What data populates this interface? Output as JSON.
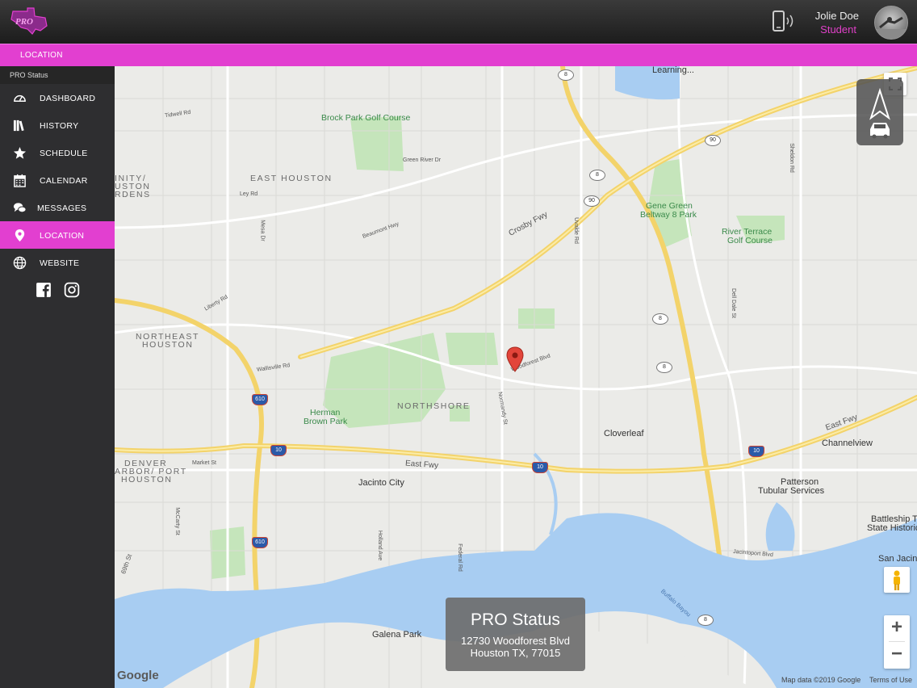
{
  "header": {
    "user_name": "Jolie Doe",
    "user_role": "Student"
  },
  "location_bar": {
    "title": "LOCATION"
  },
  "sidebar": {
    "section_title": "PRO Status",
    "items": [
      {
        "label": "DASHBOARD",
        "icon": "dashboard-icon"
      },
      {
        "label": "HISTORY",
        "icon": "books-icon"
      },
      {
        "label": "SCHEDULE",
        "icon": "star-icon"
      },
      {
        "label": "CALENDAR",
        "icon": "calendar-icon"
      },
      {
        "label": "MESSAGES",
        "icon": "chat-icon"
      },
      {
        "label": "LOCATION",
        "icon": "pin-icon",
        "active": true
      },
      {
        "label": "WEBSITE",
        "icon": "globe-icon"
      }
    ],
    "social": [
      "facebook-icon",
      "instagram-icon"
    ]
  },
  "map": {
    "areas": [
      "EAST HOUSTON",
      "NORTHEAST",
      "HOUSTON",
      "NORTHSHORE",
      "DENVER",
      "ARBOR/ PORT",
      "HOUSTON",
      "INITY/",
      "USTON",
      "RDENS"
    ],
    "places": {
      "brock_park": "Brock Park Golf Course",
      "gene_green_1": "Gene Green",
      "gene_green_2": "Beltway 8 Park",
      "river_terrace_1": "River Terrace",
      "river_terrace_2": "Golf Course",
      "herman_1": "Herman",
      "herman_2": "Brown Park",
      "cloverleaf": "Cloverleaf",
      "channelview": "Channelview",
      "jacinto_city": "Jacinto City",
      "galena_park": "Galena Park",
      "patterson_1": "Patterson",
      "patterson_2": "Tubular Services",
      "battleship_1": "Battleship T",
      "battleship_2": "State Historic",
      "san_jacinto": "San Jacinto",
      "learning": "Learning..."
    },
    "roads": {
      "crosby": "Crosby Fwy",
      "east_fwy": "East Fwy",
      "east_fwy2": "East Fwy",
      "wallisville": "Wallisville Rd",
      "woodforest": "Woodforest Blvd",
      "market": "Market St",
      "tidwell": "Tidwell Rd",
      "green_river": "Green River Dr",
      "beaumont": "Beaumont Hwy",
      "uvalde": "Uvalde Rd",
      "federal": "Federal Rd",
      "holland": "Holland Ave",
      "liberty": "Liberty Rd",
      "dell_dale": "Dell Dale St",
      "sheldon": "Sheldon Rd",
      "buffalo": "Buffalo Bayou",
      "ley": "Ley Rd",
      "mesa": "Mesa Dr",
      "normandy": "Normandy St",
      "jacintoport": "Jacintoport Blvd",
      "mccarty": "McCarty St",
      "69th": "69th St"
    },
    "shields": [
      "8",
      "90",
      "8",
      "90",
      "610",
      "10",
      "10",
      "10",
      "610",
      "8",
      "8",
      "8"
    ],
    "infobox": {
      "title": "PRO Status",
      "line1": "12730 Woodforest Blvd",
      "line2": "Houston TX, 77015"
    },
    "attribution": "Map data ©2019 Google",
    "terms": "Terms of Use",
    "google": "Google",
    "zoom_in": "+",
    "zoom_out": "−"
  },
  "colors": {
    "accent": "#e23fd0",
    "topbar": "#2a2a2a",
    "sidebar": "#2e2e30",
    "map_bg": "#ebebe8",
    "highway": "#f6d76b",
    "water": "#9ec9f2",
    "park": "#bfe3b4"
  }
}
